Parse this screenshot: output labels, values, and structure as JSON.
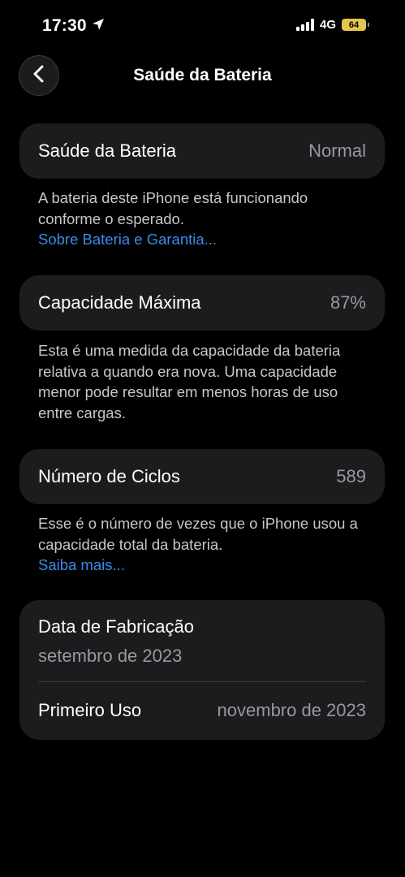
{
  "status_bar": {
    "time": "17:30",
    "network": "4G",
    "battery_label": "64",
    "location_icon": "location-arrow-icon",
    "signal_icon": "cellular-signal-icon",
    "battery_color": "#e5c64a"
  },
  "nav": {
    "title": "Saúde da Bateria",
    "back_icon": "chevron-left-icon"
  },
  "battery_health": {
    "label": "Saúde da Bateria",
    "value": "Normal",
    "description": "A bateria deste iPhone está funcionando conforme o esperado.",
    "link": "Sobre Bateria e Garantia..."
  },
  "max_capacity": {
    "label": "Capacidade Máxima",
    "value": "87%",
    "description": "Esta é uma medida da capacidade da bateria relativa a quando era nova. Uma capacidade menor pode resultar em menos horas de uso entre cargas."
  },
  "cycle_count": {
    "label": "Número de Ciclos",
    "value": "589",
    "description": "Esse é o número de vezes que o iPhone usou a capacidade total da bateria.",
    "link": "Saiba mais..."
  },
  "dates": {
    "manufacture_label": "Data de Fabricação",
    "manufacture_value": "setembro de 2023",
    "first_use_label": "Primeiro Uso",
    "first_use_value": "novembro de 2023"
  },
  "colors": {
    "background": "#000000",
    "card": "#1c1c1e",
    "link": "#3b8bea",
    "secondary_text": "#98989e"
  }
}
